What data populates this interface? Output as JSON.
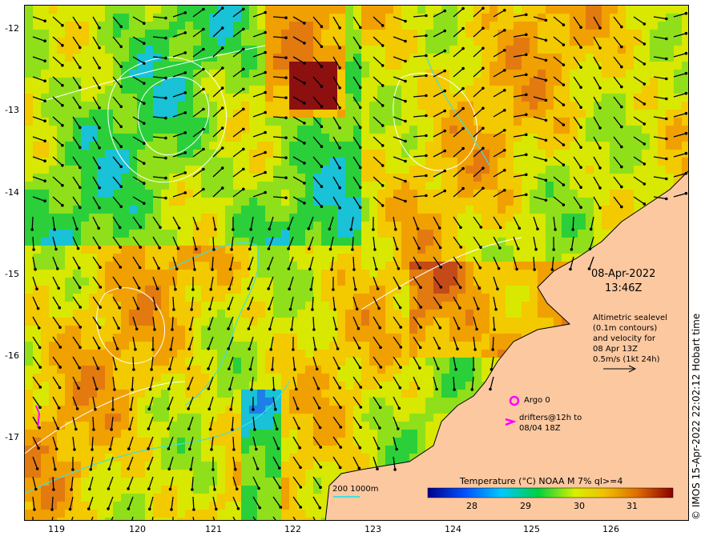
{
  "map": {
    "y_axis_labels": [
      "-12",
      "-13",
      "-14",
      "-15",
      "-16",
      "-17"
    ],
    "x_axis_labels": [
      "119",
      "120",
      "121",
      "122",
      "123",
      "124",
      "125",
      "126"
    ],
    "lat_range": [
      -17.9,
      -11.7
    ],
    "lon_range": [
      118.6,
      126.8
    ]
  },
  "annotations": {
    "date": "08-Apr-2022",
    "time": "13:46Z",
    "altimetry_lines": [
      "Altimetric sealevel",
      "(0.1m contours)",
      "and velocity for",
      "08 Apr 13Z",
      "0.5m/s (1kt 24h)"
    ],
    "argo_label": "Argo 0",
    "drifters_lines": [
      "drifters@12h to",
      "08/04 18Z"
    ],
    "depth_contours": "200  1000m",
    "copyright": "© IMOS 15-Apr-2022 22:02:12 Hobart time"
  },
  "legend": {
    "title": "Temperature (°C) NOAA  M 7% ql>=4",
    "ticks": [
      "28",
      "29",
      "30",
      "31"
    ],
    "range": [
      27.3,
      31.7
    ]
  },
  "colors": {
    "land": "#fcc8a0",
    "contour": "#ffffff",
    "bathymetry": "#40e0e0",
    "argo": "#ff00ff",
    "arrow": "#000000"
  }
}
